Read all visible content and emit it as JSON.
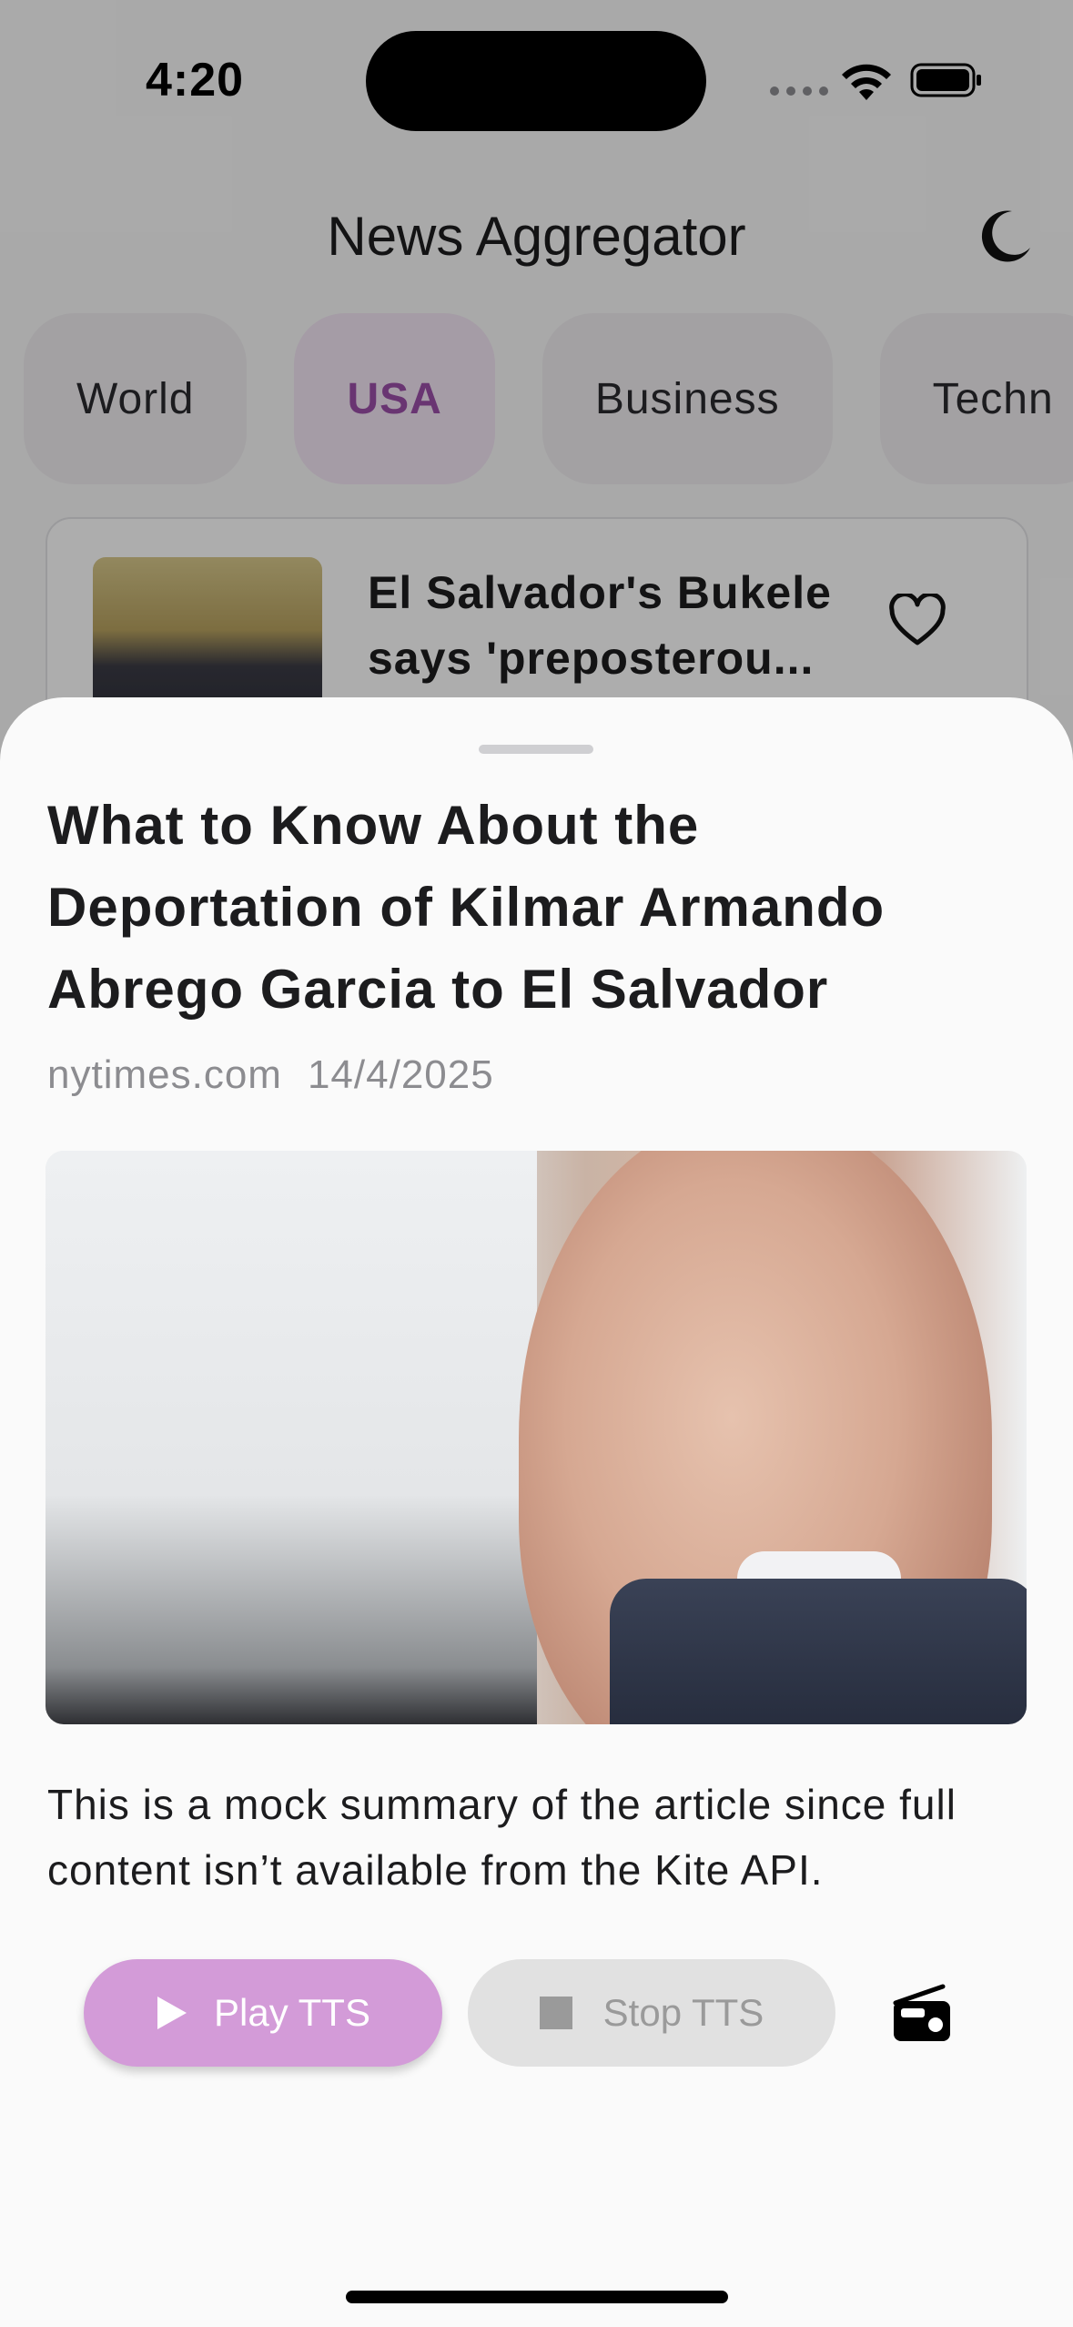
{
  "status_bar": {
    "time": "4:20"
  },
  "app_bar": {
    "title": "News Aggregator",
    "theme_toggle_icon": "moon-icon"
  },
  "tabs": [
    {
      "label": "World",
      "active": false
    },
    {
      "label": "USA",
      "active": true
    },
    {
      "label": "Business",
      "active": false
    },
    {
      "label": "Techn",
      "active": false
    }
  ],
  "list": {
    "items": [
      {
        "title": "El Salvador's Bukele says 'preposterou...",
        "favorite_icon": "heart-outline-icon"
      }
    ]
  },
  "sheet": {
    "title": "What to Know About the Deportation of Kilmar Armando Abrego Garcia to El Salvador",
    "source": "nytimes.com",
    "date": "14/4/2025",
    "summary": "This is a mock summary of the article since full content isn’t available from the Kite API.",
    "play_label": "Play TTS",
    "stop_label": "Stop TTS",
    "radio_icon": "radio-icon"
  },
  "colors": {
    "accent": "#d39bd8",
    "accent_text": "#9b4fa8",
    "disabled_bg": "#e1e1e1",
    "disabled_text": "#9a9a9a"
  }
}
